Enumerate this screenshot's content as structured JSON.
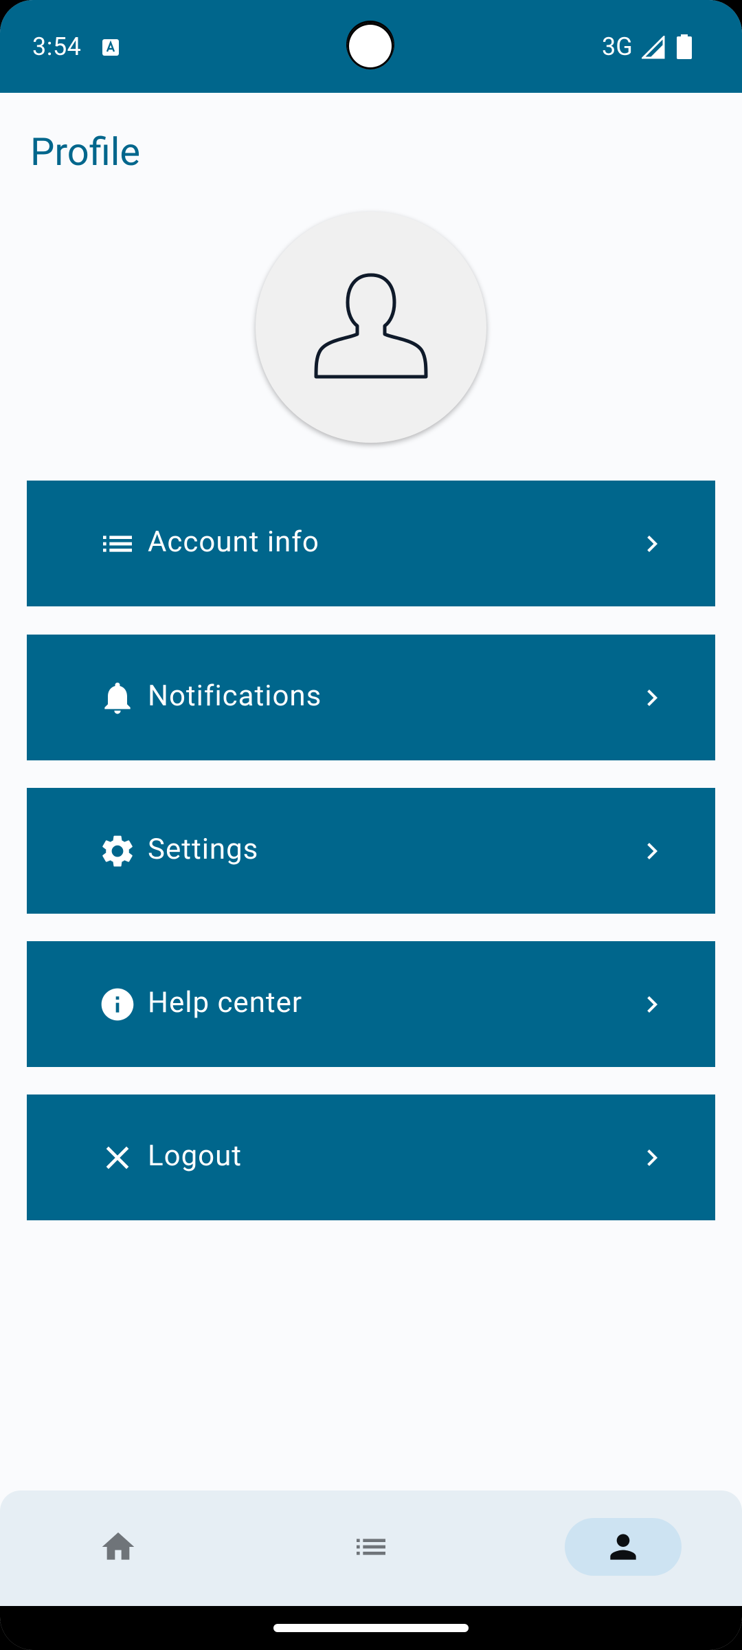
{
  "status_bar": {
    "time": "3:54",
    "network": "3G",
    "icons": [
      "text-app-icon",
      "signal-icon",
      "battery-icon"
    ]
  },
  "title": "Profile",
  "avatar": {
    "icon": "person-outline-icon"
  },
  "menu": [
    {
      "label": "Account info",
      "icon": "list-icon"
    },
    {
      "label": "Notifications",
      "icon": "bell-icon"
    },
    {
      "label": "Settings",
      "icon": "gear-icon"
    },
    {
      "label": "Help center",
      "icon": "info-icon"
    },
    {
      "label": "Logout",
      "icon": "close-icon"
    }
  ],
  "bottom_nav": [
    {
      "icon": "home-icon",
      "selected": false
    },
    {
      "icon": "list-icon",
      "selected": false
    },
    {
      "icon": "person-icon",
      "selected": true
    }
  ],
  "colors": {
    "primary": "#00668c",
    "background": "#fafbfd",
    "nav_background": "#e6eef4",
    "nav_selected": "#cde3f2"
  }
}
